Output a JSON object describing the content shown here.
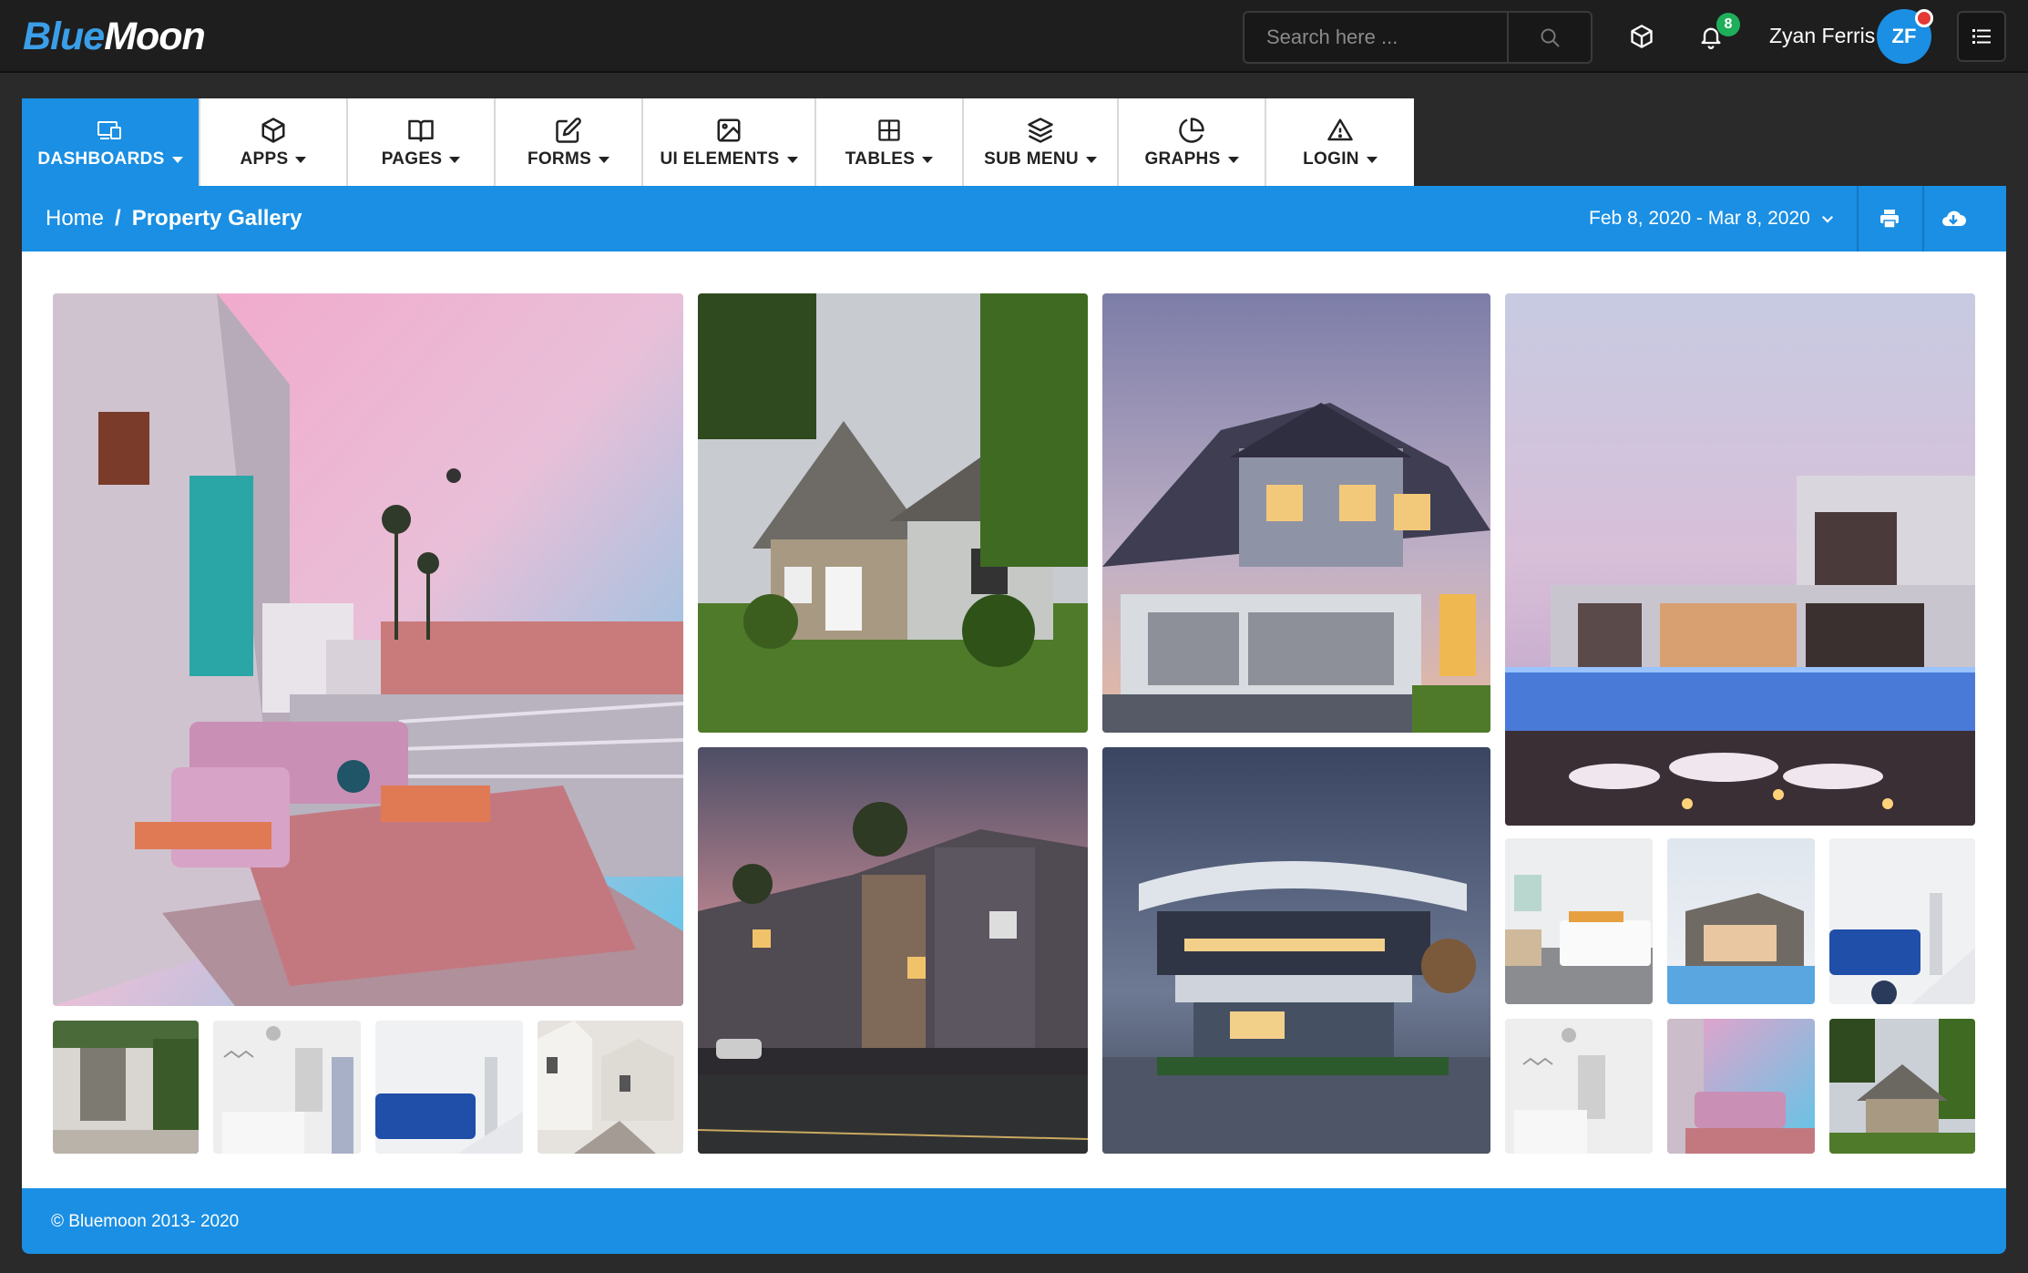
{
  "header": {
    "logo_part1": "Blue",
    "logo_part2": "Moon",
    "search_placeholder": "Search here ...",
    "notification_count": "8",
    "user_name": "Zyan Ferris",
    "user_initials": "ZF"
  },
  "nav": {
    "items": [
      {
        "label": "DASHBOARDS",
        "icon": "devices-icon",
        "active": true
      },
      {
        "label": "APPS",
        "icon": "cube-icon"
      },
      {
        "label": "PAGES",
        "icon": "book-icon"
      },
      {
        "label": "FORMS",
        "icon": "edit-icon"
      },
      {
        "label": "UI ELEMENTS",
        "icon": "image-icon"
      },
      {
        "label": "TABLES",
        "icon": "grid-icon"
      },
      {
        "label": "SUB MENU",
        "icon": "layers-icon"
      },
      {
        "label": "GRAPHS",
        "icon": "pie-chart-icon"
      },
      {
        "label": "LOGIN",
        "icon": "alert-triangle-icon"
      }
    ]
  },
  "breadcrumb": {
    "home": "Home",
    "separator": "/",
    "current": "Property Gallery"
  },
  "toolbar": {
    "date_range": "Feb 8, 2020 - Mar 8, 2020"
  },
  "gallery": {
    "images": [
      "balcony-sunset-photo",
      "brick-house-photo",
      "suburban-house-dusk-photo",
      "modern-pool-villa-photo",
      "townhouses-street-photo",
      "modern-building-night-photo",
      "kitchen-interior-photo",
      "villa-pool-thumb-photo",
      "blue-sofa-living-room-photo",
      "garden-cottage-thumb-photo",
      "nursery-room-thumb-photo",
      "blue-sofa-thumb-photo",
      "white-street-houses-thumb-photo",
      "nursery-room-thumb-2-photo",
      "balcony-thumb-photo",
      "brick-house-thumb-photo"
    ]
  },
  "footer": {
    "copyright": "© Bluemoon 2013- 2020"
  },
  "colors": {
    "primary": "#1a8fe3",
    "header_bg": "#1e1e1e",
    "badge": "#1fae5a",
    "alert_dot": "#e53935"
  }
}
